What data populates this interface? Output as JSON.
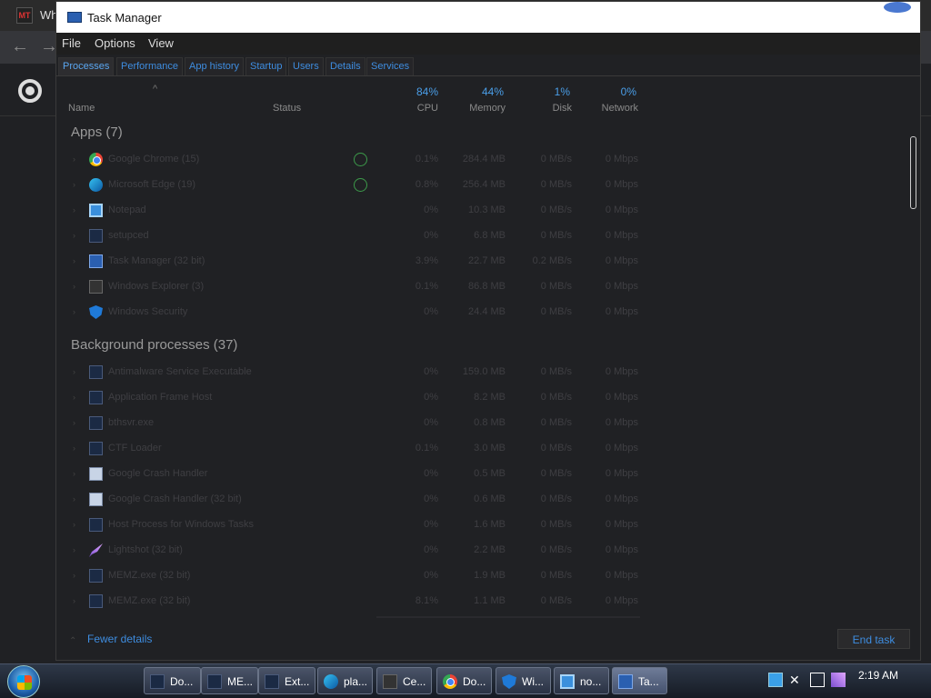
{
  "browser": {
    "tab_icon_text": "MT",
    "tab_title": "Wh"
  },
  "window": {
    "title": "Task Manager"
  },
  "menu": [
    "File",
    "Options",
    "View"
  ],
  "tabs": [
    "Processes",
    "Performance",
    "App history",
    "Startup",
    "Users",
    "Details",
    "Services"
  ],
  "columns": {
    "name": "Name",
    "status": "Status",
    "cpu_pct": "84%",
    "cpu": "CPU",
    "memory_pct": "44%",
    "memory": "Memory",
    "disk_pct": "1%",
    "disk": "Disk",
    "network_pct": "0%",
    "network": "Network"
  },
  "groups": {
    "apps": "Apps (7)",
    "background": "Background processes (37)"
  },
  "apps": [
    {
      "name": "Google Chrome (15)",
      "cpu": "0.1%",
      "memory": "284.4 MB",
      "disk": "0 MB/s",
      "network": "0 Mbps",
      "icon": "chrome-icon"
    },
    {
      "name": "Microsoft Edge (19)",
      "cpu": "0.8%",
      "memory": "256.4 MB",
      "disk": "0 MB/s",
      "network": "0 Mbps",
      "icon": "edge-icon"
    },
    {
      "name": "Notepad",
      "cpu": "0%",
      "memory": "10.3 MB",
      "disk": "0 MB/s",
      "network": "0 Mbps",
      "icon": "notepad-icon"
    },
    {
      "name": "setupced",
      "cpu": "0%",
      "memory": "6.8 MB",
      "disk": "0 MB/s",
      "network": "0 Mbps",
      "icon": "exe-icon"
    },
    {
      "name": "Task Manager (32 bit)",
      "cpu": "3.9%",
      "memory": "22.7 MB",
      "disk": "0.2 MB/s",
      "network": "0 Mbps",
      "icon": "task-manager-icon"
    },
    {
      "name": "Windows Explorer (3)",
      "cpu": "0.1%",
      "memory": "86.8 MB",
      "disk": "0 MB/s",
      "network": "0 Mbps",
      "icon": "explorer-icon"
    },
    {
      "name": "Windows Security",
      "cpu": "0%",
      "memory": "24.4 MB",
      "disk": "0 MB/s",
      "network": "0 Mbps",
      "icon": "shield-icon"
    }
  ],
  "background": [
    {
      "name": "Antimalware Service Executable",
      "cpu": "0%",
      "memory": "159.0 MB",
      "disk": "0 MB/s",
      "network": "0 Mbps",
      "icon": "exe-icon"
    },
    {
      "name": "Application Frame Host",
      "cpu": "0%",
      "memory": "8.2 MB",
      "disk": "0 MB/s",
      "network": "0 Mbps",
      "icon": "exe-icon"
    },
    {
      "name": "bthsvr.exe",
      "cpu": "0%",
      "memory": "0.8 MB",
      "disk": "0 MB/s",
      "network": "0 Mbps",
      "icon": "exe-icon"
    },
    {
      "name": "CTF Loader",
      "cpu": "0.1%",
      "memory": "3.0 MB",
      "disk": "0 MB/s",
      "network": "0 Mbps",
      "icon": "exe-icon"
    },
    {
      "name": "Google Crash Handler",
      "cpu": "0%",
      "memory": "0.5 MB",
      "disk": "0 MB/s",
      "network": "0 Mbps",
      "icon": "crash-handler-icon"
    },
    {
      "name": "Google Crash Handler (32 bit)",
      "cpu": "0%",
      "memory": "0.6 MB",
      "disk": "0 MB/s",
      "network": "0 Mbps",
      "icon": "crash-handler-icon"
    },
    {
      "name": "Host Process for Windows Tasks",
      "cpu": "0%",
      "memory": "1.6 MB",
      "disk": "0 MB/s",
      "network": "0 Mbps",
      "icon": "exe-icon"
    },
    {
      "name": "Lightshot (32 bit)",
      "cpu": "0%",
      "memory": "2.2 MB",
      "disk": "0 MB/s",
      "network": "0 Mbps",
      "icon": "feather-icon"
    },
    {
      "name": "MEMZ.exe (32 bit)",
      "cpu": "0%",
      "memory": "1.9 MB",
      "disk": "0 MB/s",
      "network": "0 Mbps",
      "icon": "exe-icon"
    },
    {
      "name": "MEMZ.exe (32 bit)",
      "cpu": "8.1%",
      "memory": "1.1 MB",
      "disk": "0 MB/s",
      "network": "0 Mbps",
      "icon": "exe-icon"
    }
  ],
  "footer": {
    "fewer_details": "Fewer details",
    "end_task": "End task"
  },
  "taskbar": {
    "items": [
      {
        "label": "Do...",
        "icon": "exe-icon"
      },
      {
        "label": "ME...",
        "icon": "exe-icon"
      },
      {
        "label": "Ext...",
        "icon": "exe-icon"
      },
      {
        "label": "pla...",
        "icon": "edge-icon"
      },
      {
        "label": "Ce...",
        "icon": "folder-icon"
      },
      {
        "label": "Do...",
        "icon": "chrome-icon"
      },
      {
        "label": "Wi...",
        "icon": "shield-icon"
      },
      {
        "label": "no...",
        "icon": "notepad-icon"
      },
      {
        "label": "Ta...",
        "icon": "task-manager-icon"
      }
    ],
    "clock": "2:19 AM"
  }
}
